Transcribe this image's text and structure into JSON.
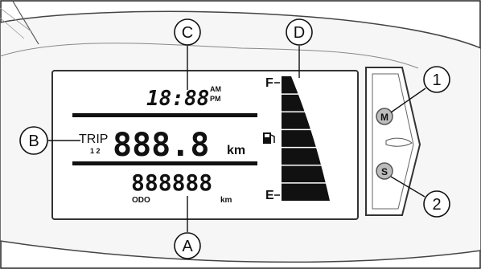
{
  "callouts": {
    "A": "A",
    "B": "B",
    "C": "C",
    "D": "D",
    "one": "1",
    "two": "2"
  },
  "display": {
    "clock": "18:88",
    "am": "AM",
    "pm": "PM",
    "trip_label": "TRIP",
    "trip_sub": "1 2",
    "trip_value": "888.8",
    "trip_unit": "km",
    "odo_value": "888888",
    "odo_label": "ODO",
    "odo_unit": "km"
  },
  "fuel_gauge": {
    "full_label": "F",
    "empty_label": "E",
    "icon": "fuel-pump-icon",
    "segments": 7
  },
  "buttons": {
    "mode": "M",
    "set": "S"
  }
}
